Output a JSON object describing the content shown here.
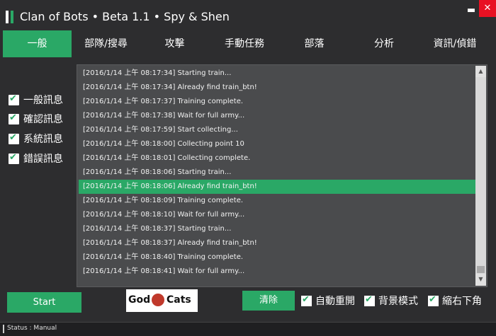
{
  "window": {
    "title": "Clan of Bots • Beta 1.1 • Spy & Shen",
    "minimize_label": "▬",
    "close_label": "✕"
  },
  "tabs": [
    {
      "label": "一般",
      "active": true
    },
    {
      "label": "部隊/搜尋",
      "active": false
    },
    {
      "label": "攻擊",
      "active": false
    },
    {
      "label": "手動任務",
      "active": false
    },
    {
      "label": "部落",
      "active": false
    },
    {
      "label": "分析",
      "active": false
    },
    {
      "label": "資訊/偵錯",
      "active": false
    }
  ],
  "filters": [
    {
      "label": "一般訊息",
      "checked": true
    },
    {
      "label": "確認訊息",
      "checked": true
    },
    {
      "label": "系統訊息",
      "checked": true
    },
    {
      "label": "錯誤訊息",
      "checked": true
    }
  ],
  "log": [
    {
      "text": "[2016/1/14 上午 08:17:34] Starting train...",
      "selected": false
    },
    {
      "text": "[2016/1/14 上午 08:17:34] Already find train_btn!",
      "selected": false
    },
    {
      "text": "[2016/1/14 上午 08:17:37] Training complete.",
      "selected": false
    },
    {
      "text": "[2016/1/14 上午 08:17:38] Wait for full army...",
      "selected": false
    },
    {
      "text": "[2016/1/14 上午 08:17:59] Start collecting...",
      "selected": false
    },
    {
      "text": "[2016/1/14 上午 08:18:00] Collecting point 10",
      "selected": false
    },
    {
      "text": "[2016/1/14 上午 08:18:01] Collecting complete.",
      "selected": false
    },
    {
      "text": "[2016/1/14 上午 08:18:06] Starting train...",
      "selected": false
    },
    {
      "text": "[2016/1/14 上午 08:18:06] Already find train_btn!",
      "selected": true
    },
    {
      "text": "[2016/1/14 上午 08:18:09] Training complete.",
      "selected": false
    },
    {
      "text": "[2016/1/14 上午 08:18:10] Wait for full army...",
      "selected": false
    },
    {
      "text": "[2016/1/14 上午 08:18:37] Starting train...",
      "selected": false
    },
    {
      "text": "[2016/1/14 上午 08:18:37] Already find train_btn!",
      "selected": false
    },
    {
      "text": "[2016/1/14 上午 08:18:40] Training complete.",
      "selected": false
    },
    {
      "text": "[2016/1/14 上午 08:18:41] Wait for full army...",
      "selected": false
    }
  ],
  "controls": {
    "start_label": "Start",
    "clear_label": "清除",
    "logo_left": "God",
    "logo_right": "Cats",
    "options": [
      {
        "label": "自動重開",
        "checked": true
      },
      {
        "label": "背景模式",
        "checked": true
      },
      {
        "label": "縮右下角",
        "checked": true
      }
    ]
  },
  "status": {
    "text": "Status : Manual"
  },
  "colors": {
    "accent": "#2aa866",
    "background": "#2d2d2f",
    "log_background": "#4a4b4d",
    "close": "#e81123"
  }
}
